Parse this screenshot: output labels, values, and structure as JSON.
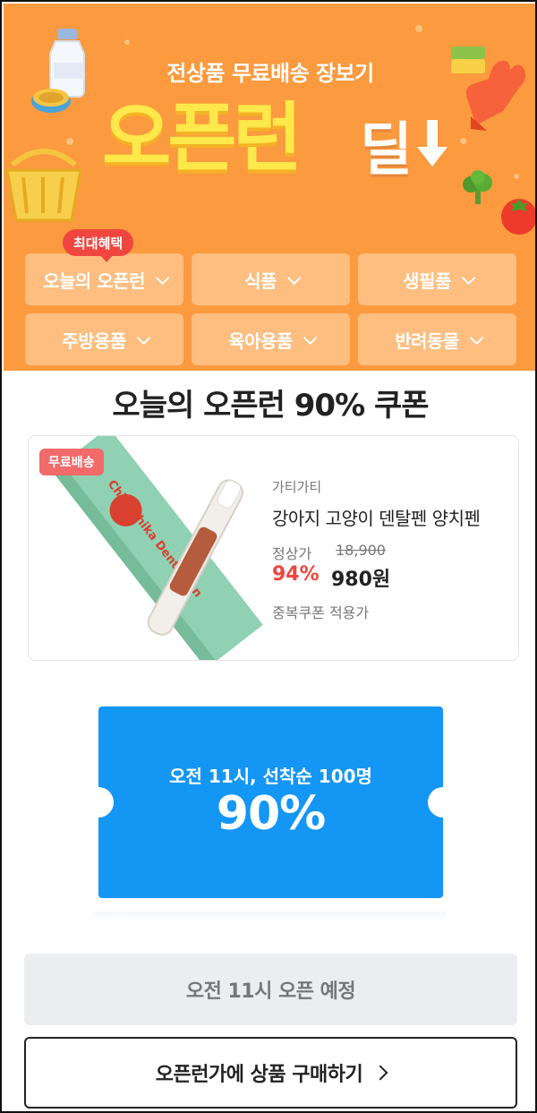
{
  "hero": {
    "subtitle": "전상품 무료배송 장보기",
    "title_main": "오픈런",
    "title_deal": "딜",
    "bg_color": "#fb9a3e",
    "title_color": "#ffe84a"
  },
  "badge": {
    "label": "최대혜택"
  },
  "categories": [
    {
      "label": "오늘의 오픈런"
    },
    {
      "label": "식품"
    },
    {
      "label": "생필품"
    },
    {
      "label": "주방용품"
    },
    {
      "label": "육아용품"
    },
    {
      "label": "반려동물"
    }
  ],
  "section": {
    "title": "오늘의 오픈런 90% 쿠폰"
  },
  "product": {
    "shipping_badge": "무료배송",
    "brand": "가티가티",
    "name": "강아지 고양이 덴탈펜 양치펜",
    "original_label": "정상가",
    "original_price": "18,900",
    "discount": "94%",
    "sale_price": "980원",
    "coupon_note": "중복쿠폰 적용가",
    "pen_text": "ChikaChika DentalPen",
    "discount_color": "#f0463f"
  },
  "coupon": {
    "condition": "오전 11시, 선착순 100명",
    "rate": "90%",
    "color": "#1496f5"
  },
  "buttons": {
    "open_scheduled": "오전 11시 오픈 예정",
    "buy": "오픈런가에 상품 구매하기"
  }
}
